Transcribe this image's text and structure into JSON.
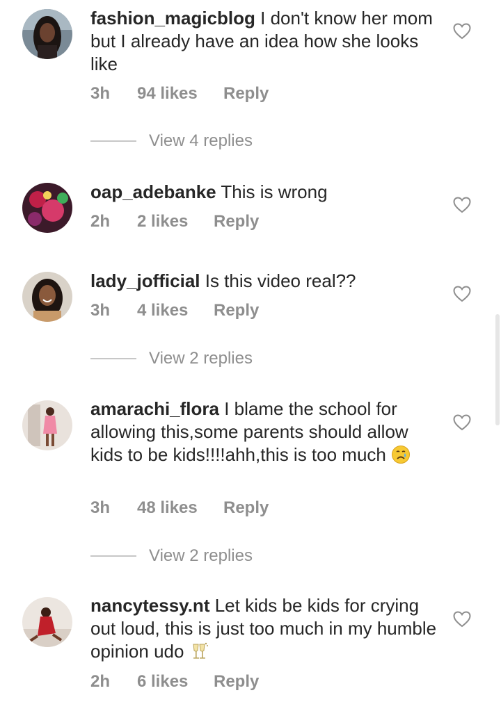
{
  "comments": [
    {
      "username": "fashion_magicblog",
      "text": " I don't know her mom but I already have an idea how she looks like",
      "time": "3h",
      "likes": "94 likes",
      "reply": "Reply",
      "view_replies": "View 4 replies"
    },
    {
      "username": "oap_adebanke",
      "text": " This is wrong",
      "time": "2h",
      "likes": "2 likes",
      "reply": "Reply"
    },
    {
      "username": "lady_jofficial",
      "text": " Is this video real??",
      "time": "3h",
      "likes": "4 likes",
      "reply": "Reply",
      "view_replies": "View 2 replies"
    },
    {
      "username": "amarachi_flora",
      "text": " I blame the school for allowing this,some parents should allow kids to be kids!!!!ahh,this is too much ",
      "emoji": "crying-face-emoji",
      "time": "3h",
      "likes": "48 likes",
      "reply": "Reply",
      "view_replies": "View 2 replies"
    },
    {
      "username": "nancytessy.nt",
      "text": " Let kids be kids for crying out loud, this is just too much in my humble opinion  udo ",
      "emoji": "clinking-glasses-emoji",
      "time": "2h",
      "likes": "6 likes",
      "reply": "Reply"
    }
  ],
  "colors": {
    "text": "#262626",
    "secondary": "#8e8e8e",
    "divider": "#c7c7c7"
  },
  "icons": {
    "like": "heart-outline-icon"
  }
}
